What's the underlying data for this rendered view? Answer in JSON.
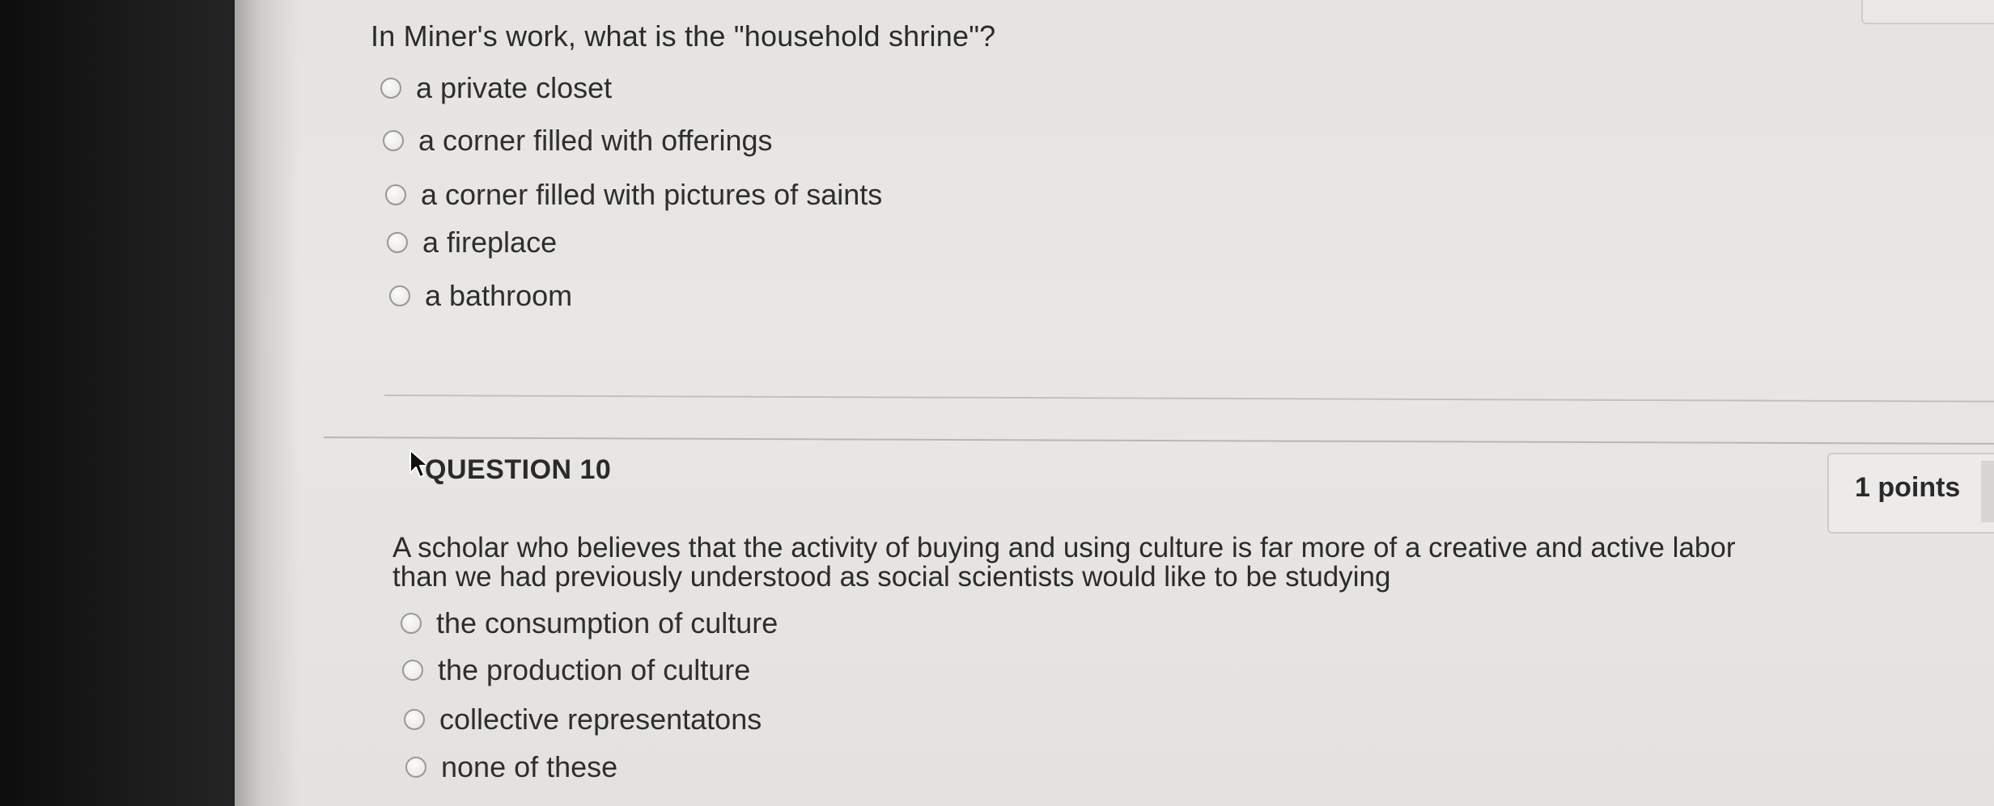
{
  "question9": {
    "prompt": "In Miner's work, what is the \"household shrine\"?",
    "options": [
      "a private closet",
      "a corner filled with offerings",
      "a corner filled with pictures of saints",
      "a fireplace",
      "a bathroom"
    ]
  },
  "question10": {
    "header": "QUESTION 10",
    "points": "1 points",
    "prompt_lines": [
      "A scholar who believes that the activity of buying and using culture is far more of a creative and active labor",
      "than we had previously understood as social scientists would like to be studying"
    ],
    "options": [
      "the consumption of culture",
      "the production of culture",
      "collective representatons",
      "none of these"
    ]
  },
  "icons": {
    "cursor": "mouse-pointer-icon",
    "radio": "radio-unchecked-icon"
  },
  "colors": {
    "page_background": "#e8e6e3",
    "text": "#2b2b2b",
    "divider": "#c2c0bd",
    "bezel": "#111111"
  }
}
